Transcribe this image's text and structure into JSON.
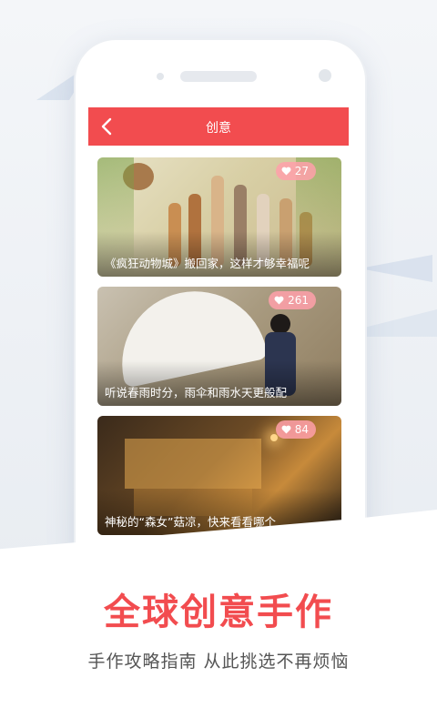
{
  "appbar": {
    "title": "创意"
  },
  "cards": [
    {
      "caption": "《疯狂动物城》搬回家，这样才够幸福呢",
      "likes": "27"
    },
    {
      "caption": "听说春雨时分，雨伞和雨水天更般配",
      "likes": "261"
    },
    {
      "caption": "神秘的“森女”菇凉，快来看看哪个",
      "likes": "84"
    }
  ],
  "promo": {
    "headline": "全球创意手作",
    "subline": "手作攻略指南 从此挑选不再烦恼"
  },
  "colors": {
    "accent": "#f24c4f",
    "badge": "#ffa0aa"
  },
  "icons": {
    "back": "chevron-left-icon",
    "like": "heart-icon"
  }
}
